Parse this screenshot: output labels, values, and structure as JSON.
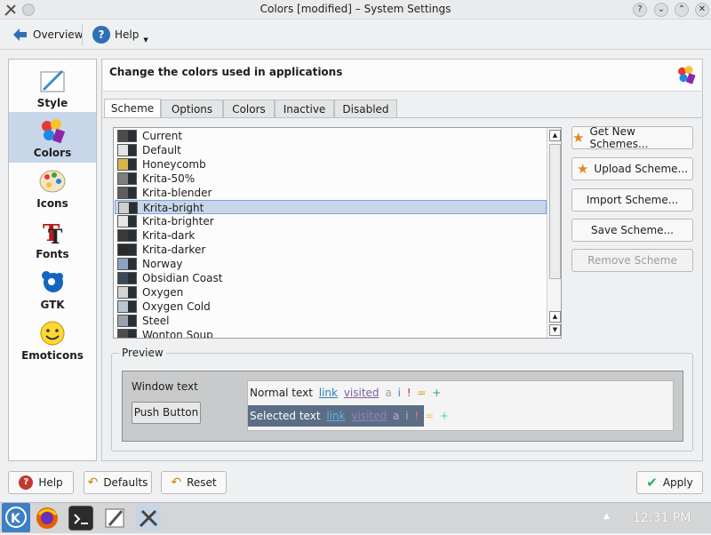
{
  "window": {
    "title": "Colors [modified] – System Settings"
  },
  "toolbar": {
    "overview_label": "Overview",
    "help_label": "Help"
  },
  "sidebar": {
    "items": [
      {
        "label": "Style",
        "icon": "style-icon"
      },
      {
        "label": "Colors",
        "icon": "colors-icon"
      },
      {
        "label": "Icons",
        "icon": "icons-icon"
      },
      {
        "label": "Fonts",
        "icon": "fonts-icon"
      },
      {
        "label": "GTK",
        "icon": "gtk-icon"
      },
      {
        "label": "Emoticons",
        "icon": "emoticons-icon"
      }
    ],
    "selected": "Colors"
  },
  "header": {
    "title": "Change the colors used in applications"
  },
  "tabs": [
    {
      "label": "Scheme",
      "active": true
    },
    {
      "label": "Options"
    },
    {
      "label": "Colors"
    },
    {
      "label": "Inactive"
    },
    {
      "label": "Disabled"
    }
  ],
  "schemes": {
    "items": [
      "Current",
      "Default",
      "Honeycomb",
      "Krita-50%",
      "Krita-blender",
      "Krita-bright",
      "Krita-brighter",
      "Krita-dark",
      "Krita-darker",
      "Norway",
      "Obsidian Coast",
      "Oxygen",
      "Oxygen Cold",
      "Steel",
      "Wonton Soup"
    ],
    "selected": "Krita-bright"
  },
  "scheme_buttons": {
    "get_new": "Get New Schemes...",
    "upload": "Upload Scheme...",
    "import": "Import Scheme...",
    "save": "Save Scheme...",
    "remove": "Remove Scheme"
  },
  "preview": {
    "legend": "Preview",
    "window_text": "Window text",
    "push_button": "Push Button",
    "normal_text": "Normal text",
    "selected_text": "Selected text",
    "link": "link",
    "visited": "visited",
    "a": "a",
    "i": "i",
    "bang": "!",
    "eq": "=",
    "plus": "+"
  },
  "footer": {
    "help": "Help",
    "defaults": "Defaults",
    "reset": "Reset",
    "apply": "Apply"
  },
  "taskbar": {
    "clock": "12:31 PM"
  },
  "colors": {
    "accent": "#3daee9",
    "selection": "#c8d6ea",
    "selected_preview_bg": "#5c6e86"
  }
}
